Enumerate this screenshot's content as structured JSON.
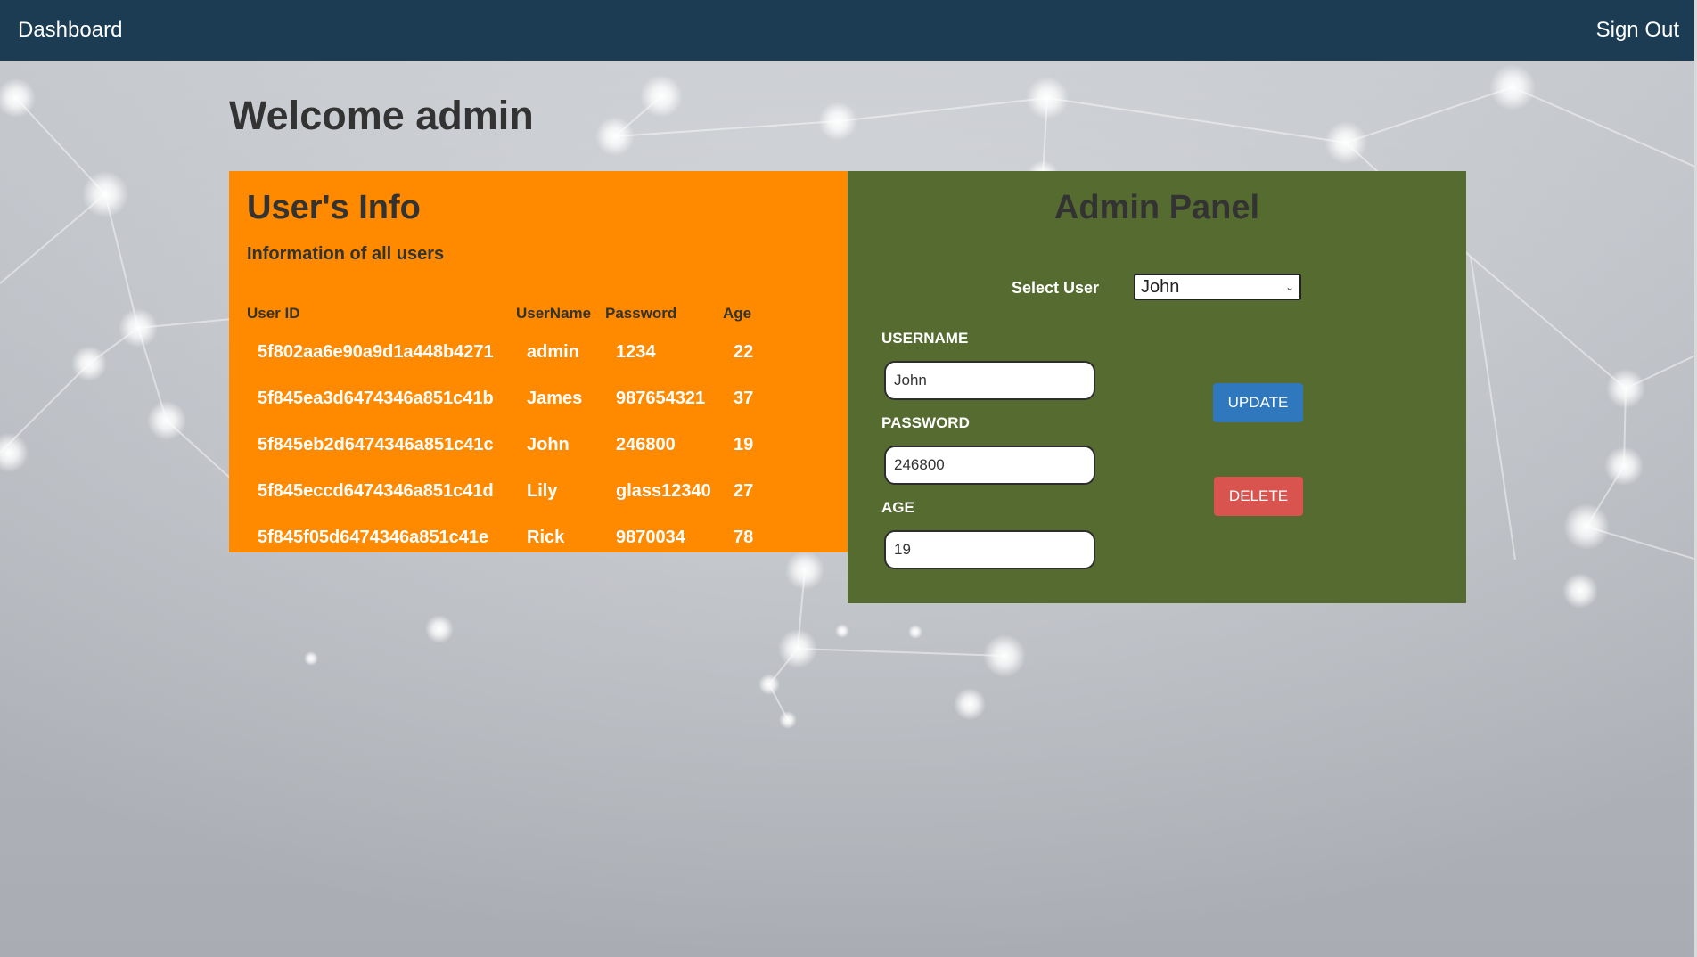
{
  "navbar": {
    "brand": "Dashboard",
    "signout": "Sign Out"
  },
  "welcome": "Welcome admin",
  "users_info": {
    "title": "User's Info",
    "subtitle": "Information of all users",
    "columns": [
      "User ID",
      "UserName",
      "Password",
      "Age"
    ],
    "rows": [
      {
        "id": "5f802aa6e90a9d1a448b4271",
        "username": "admin",
        "password": "1234",
        "age": "22"
      },
      {
        "id": "5f845ea3d6474346a851c41b",
        "username": "James",
        "password": "987654321",
        "age": "37"
      },
      {
        "id": "5f845eb2d6474346a851c41c",
        "username": "John",
        "password": "246800",
        "age": "19"
      },
      {
        "id": "5f845eccd6474346a851c41d",
        "username": "Lily",
        "password": "glass12340",
        "age": "27"
      },
      {
        "id": "5f845f05d6474346a851c41e",
        "username": "Rick",
        "password": "9870034",
        "age": "78"
      }
    ]
  },
  "admin_panel": {
    "title": "Admin Panel",
    "select_label": "Select User",
    "selected_user": "John",
    "username_label": "USERNAME",
    "username_value": "John",
    "password_label": "PASSWORD",
    "password_value": "246800",
    "age_label": "AGE",
    "age_value": "19",
    "update_label": "UPDATE",
    "delete_label": "DELETE"
  },
  "colors": {
    "navbar": "#1b3c53",
    "info_panel": "#ff8a00",
    "admin_panel": "#556b30",
    "update_button": "#2f78bd",
    "delete_button": "#d9534f"
  },
  "icons": {
    "select_arrow": "chevron-down-icon"
  }
}
